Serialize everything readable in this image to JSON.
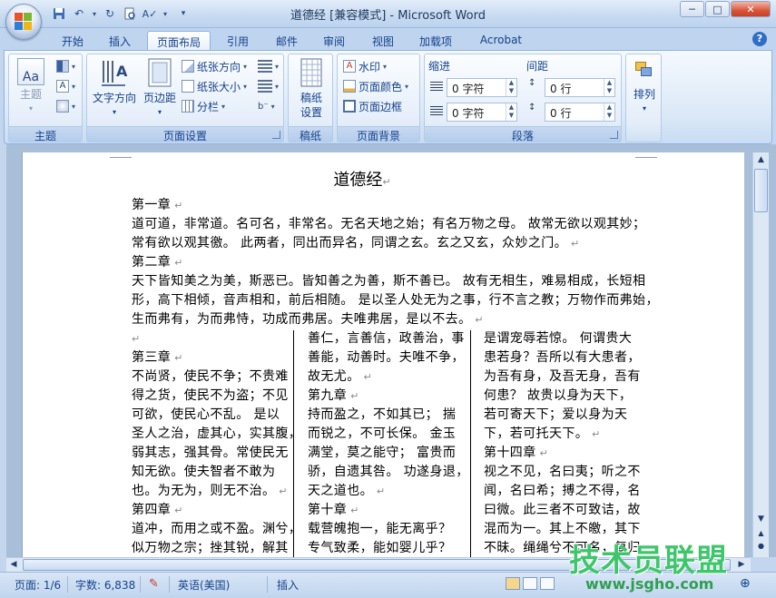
{
  "window": {
    "title": "道德经 [兼容模式] - Microsoft Word",
    "minimize": "─",
    "maximize": "□",
    "close": "✕"
  },
  "qat": {
    "save_icon": "save-icon",
    "undo_icon": "undo-icon",
    "redo_icon": "redo-icon"
  },
  "tabs": [
    {
      "label": "开始"
    },
    {
      "label": "插入"
    },
    {
      "label": "页面布局",
      "active": true
    },
    {
      "label": "引用"
    },
    {
      "label": "邮件"
    },
    {
      "label": "审阅"
    },
    {
      "label": "视图"
    },
    {
      "label": "加载项"
    },
    {
      "label": "Acrobat"
    }
  ],
  "ribbon": {
    "theme": {
      "group_label": "主题",
      "themes_button": "主题",
      "theme_icon_label": "Aa"
    },
    "page_setup": {
      "group_label": "页面设置",
      "text_direction": "文字方向",
      "margins": "页边距",
      "orientation": "纸张方向",
      "size": "纸张大小",
      "columns": "分栏"
    },
    "draft": {
      "group_label": "稿纸",
      "draft_settings_line1": "稿纸",
      "draft_settings_line2": "设置"
    },
    "page_background": {
      "group_label": "页面背景",
      "watermark": "水印",
      "page_color": "页面颜色",
      "page_borders": "页面边框"
    },
    "paragraph": {
      "group_label": "段落",
      "indent_label": "缩进",
      "spacing_label": "间距",
      "indent_left": "0 字符",
      "indent_right": "0 字符",
      "spacing_before": "0 行",
      "spacing_after": "0 行"
    },
    "arrange": {
      "label": "排列"
    }
  },
  "document": {
    "title": "道德经",
    "full_lines": [
      "第一章",
      "道可道，非常道。名可名，非常名。无名天地之始；有名万物之母。 故常无欲以观其妙；",
      "常有欲以观其徼。 此两者，同出而异名，同谓之玄。玄之又玄，众妙之门。",
      "第二章",
      "天下皆知美之为美，斯恶已。皆知善之为善，斯不善已。 故有无相生，难易相成，长短相",
      "形，高下相倾，音声相和，前后相随。 是以圣人处无为之事，行不言之教；万物作而弗始，",
      "生而弗有，为而弗恃，功成而弗居。夫唯弗居，是以不去。"
    ],
    "col1": [
      "",
      "第三章",
      "不尚贤，使民不争；不贵难",
      "得之货，使民不为盗；不见",
      "可欲，使民心不乱。 是以",
      "圣人之治，虚其心，实其腹，",
      "弱其志，强其骨。常使民无",
      "知无欲。使夫智者不敢为",
      "也。为无为，则无不治。",
      "第四章",
      "道冲，而用之或不盈。渊兮，",
      "似万物之宗；挫其锐，解其"
    ],
    "col2": [
      "善仁，言善信，政善治，事",
      "善能，动善时。夫唯不争，",
      "故无尤。",
      "第九章",
      "持而盈之，不如其已； 揣",
      "而锐之，不可长保。 金玉",
      "满堂，莫之能守； 富贵而",
      "骄，自遗其咎。 功遂身退，",
      "天之道也。",
      "第十章",
      "载营魄抱一，能无离乎？",
      "专气致柔，能如婴儿乎？"
    ],
    "col3": [
      "是谓宠辱若惊。 何谓贵大",
      "患若身？吾所以有大患者，",
      "为吾有身，及吾无身，吾有",
      "何患？ 故贵以身为天下，",
      "若可寄天下；爱以身为天",
      "下，若可托天下。",
      "第十四章",
      "视之不见，名曰夷；听之不",
      "闻，名曰希；搏之不得，名",
      "曰微。此三者不可致诘，故",
      "混而为一。其上不皦，其下",
      "不昧。绳绳兮不可名，复归"
    ]
  },
  "status": {
    "page": "页面: 1/6",
    "words": "字数: 6,838",
    "language": "英语(美国)",
    "mode": "插入"
  },
  "watermark": {
    "big": "技术员联盟",
    "url": "www.jsgho.com"
  }
}
